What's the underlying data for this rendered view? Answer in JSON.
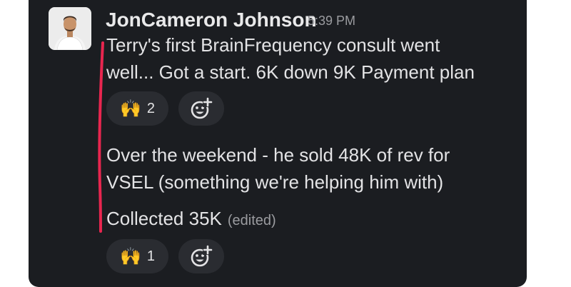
{
  "message": {
    "sender": "JonCameron Johnson",
    "time": "5:39 PM",
    "blocks": [
      {
        "lines": [
          "Terry's first BrainFrequency consult went",
          "well... Got a start. 6K down 9K Payment plan"
        ],
        "reaction": {
          "emoji": "🙌",
          "emoji_icon": "raised-hands-icon",
          "count": "2"
        }
      },
      {
        "lines": [
          "Over the weekend - he sold 48K of rev for",
          "VSEL (something we're helping him with)"
        ]
      },
      {
        "lines": [
          "Collected 35K"
        ],
        "edited": "(edited)",
        "reaction": {
          "emoji": "🙌",
          "emoji_icon": "raised-hands-icon",
          "count": "1"
        }
      }
    ],
    "add_reaction_icon": "add-reaction-icon"
  },
  "colors": {
    "background": "#1b1d21",
    "text": "#e3e3e5",
    "muted": "#9b9ca0",
    "reaction_pill": "#2a2c31",
    "annotation_line": "#e8264f"
  }
}
